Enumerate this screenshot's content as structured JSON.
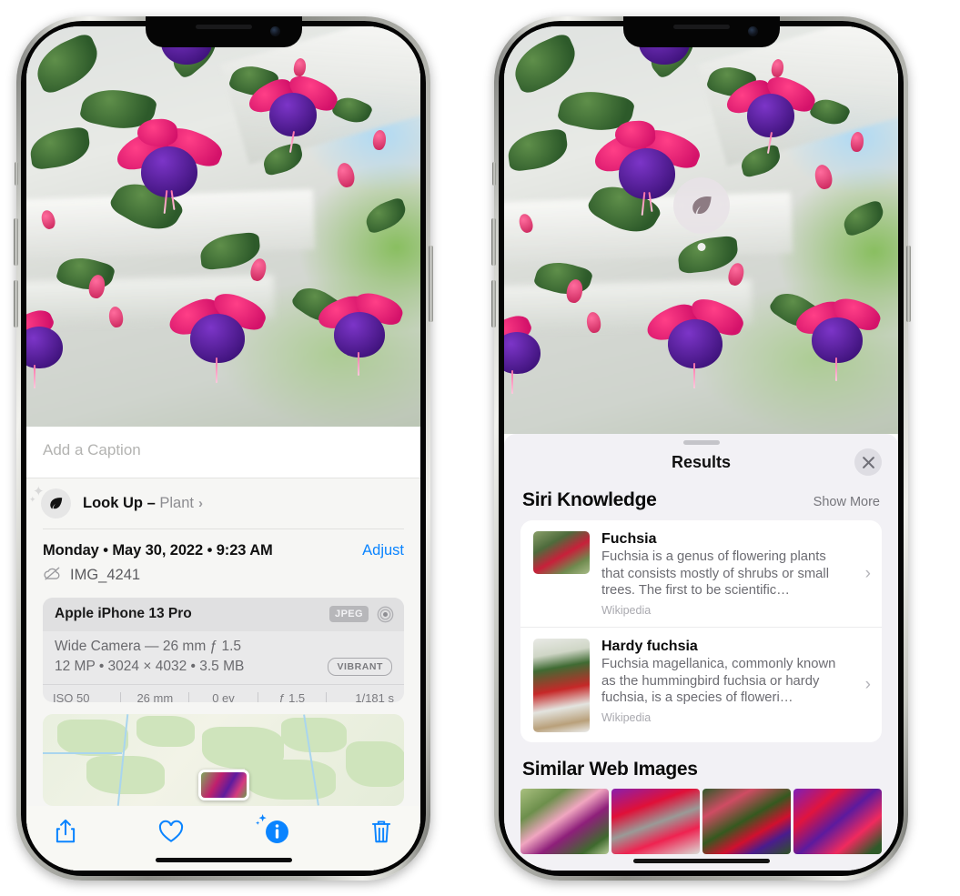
{
  "left_phone": {
    "photo": {
      "alt": "fuchsia-flowers-photo"
    },
    "caption": {
      "placeholder": "Add a Caption",
      "value": ""
    },
    "look_up": {
      "icon": "leaf-icon",
      "label": "Look Up – ",
      "subject": "Plant",
      "chevron": "›"
    },
    "metadata": {
      "date_line": "Monday • May 30, 2022 • 9:23 AM",
      "adjust_label": "Adjust",
      "cloud_icon": "cloud-slash-icon",
      "filename": "IMG_4241"
    },
    "camera_card": {
      "model": "Apple iPhone 13 Pro",
      "format_badge": "JPEG",
      "hdr_icon": "hdr-circles-icon",
      "lens_line": "Wide Camera — 26 mm ƒ 1.5",
      "detail_line": "12 MP • 3024 × 4032 • 3.5 MB",
      "vibrant_badge": "VIBRANT",
      "exif": [
        "ISO 50",
        "26 mm",
        "0 ev",
        "ƒ 1.5",
        "1/181 s"
      ]
    },
    "map": {
      "name": "location-map-preview",
      "pin": "photo-thumbnail-pin"
    },
    "toolbar": [
      {
        "name": "share-button",
        "icon": "share-icon"
      },
      {
        "name": "favorite-button",
        "icon": "heart-icon"
      },
      {
        "name": "info-button",
        "icon": "info-sparkle-icon"
      },
      {
        "name": "delete-button",
        "icon": "trash-icon"
      }
    ],
    "accent_color": "#0a84ff"
  },
  "right_phone": {
    "photo": {
      "alt": "fuchsia-flowers-photo"
    },
    "leaf_badge": {
      "icon": "leaf-icon",
      "label": "visual-lookup-badge"
    },
    "sheet": {
      "title": "Results",
      "close_icon": "close-icon",
      "sections": [
        {
          "title": "Siri Knowledge",
          "action": "Show More",
          "cards": [
            {
              "name": "Fuchsia",
              "description": "Fuchsia is a genus of flowering plants that consists mostly of shrubs or small trees. The first to be scientific…",
              "source": "Wikipedia",
              "chevron": "›"
            },
            {
              "name": "Hardy fuchsia",
              "description": "Fuchsia magellanica, commonly known as the hummingbird fuchsia or hardy fuchsia, is a species of floweri…",
              "source": "Wikipedia",
              "chevron": "›"
            }
          ]
        },
        {
          "title": "Similar Web Images",
          "thumbnails": [
            "fuchsia-web-image-1",
            "fuchsia-web-image-2",
            "fuchsia-web-image-3",
            "fuchsia-web-image-4"
          ]
        }
      ]
    }
  }
}
